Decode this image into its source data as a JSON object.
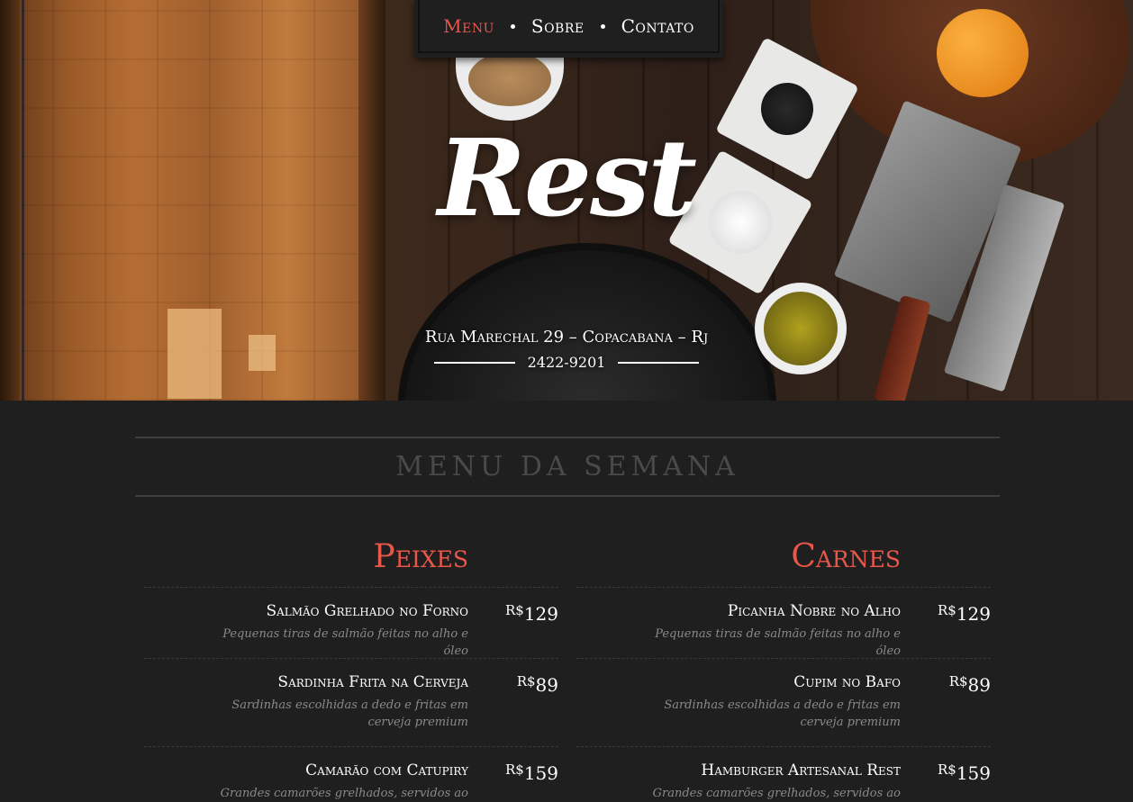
{
  "nav": {
    "items": [
      {
        "label": "Menu",
        "active": true
      },
      {
        "label": "Sobre",
        "active": false
      },
      {
        "label": "Contato",
        "active": false
      }
    ]
  },
  "hero": {
    "logo": "Rest",
    "address": "Rua Marechal 29 – Copacabana – Rj",
    "phone": "2422-9201"
  },
  "menu": {
    "title": "MENU DA SEMANA",
    "currency": "R$",
    "accent_color": "#e9564a",
    "columns": [
      {
        "title": "Peixes",
        "items": [
          {
            "name": "Salmão Grelhado no Forno",
            "desc": "Pequenas tiras de salmão feitas no alho e óleo",
            "price": "129"
          },
          {
            "name": "Sardinha Frita na Cerveja",
            "desc": "Sardinhas escolhidas a dedo e fritas em cerveja premium",
            "price": "89"
          },
          {
            "name": "Camarão com Catupiry",
            "desc": "Grandes camarões grelhados, servidos ao",
            "price": "159"
          }
        ]
      },
      {
        "title": "Carnes",
        "items": [
          {
            "name": "Picanha Nobre no Alho",
            "desc": "Pequenas tiras de salmão feitas no alho e óleo",
            "price": "129"
          },
          {
            "name": "Cupim no Bafo",
            "desc": "Sardinhas escolhidas a dedo e fritas em cerveja premium",
            "price": "89"
          },
          {
            "name": "Hamburger Artesanal Rest",
            "desc": "Grandes camarões grelhados, servidos ao",
            "price": "159"
          }
        ]
      }
    ]
  }
}
